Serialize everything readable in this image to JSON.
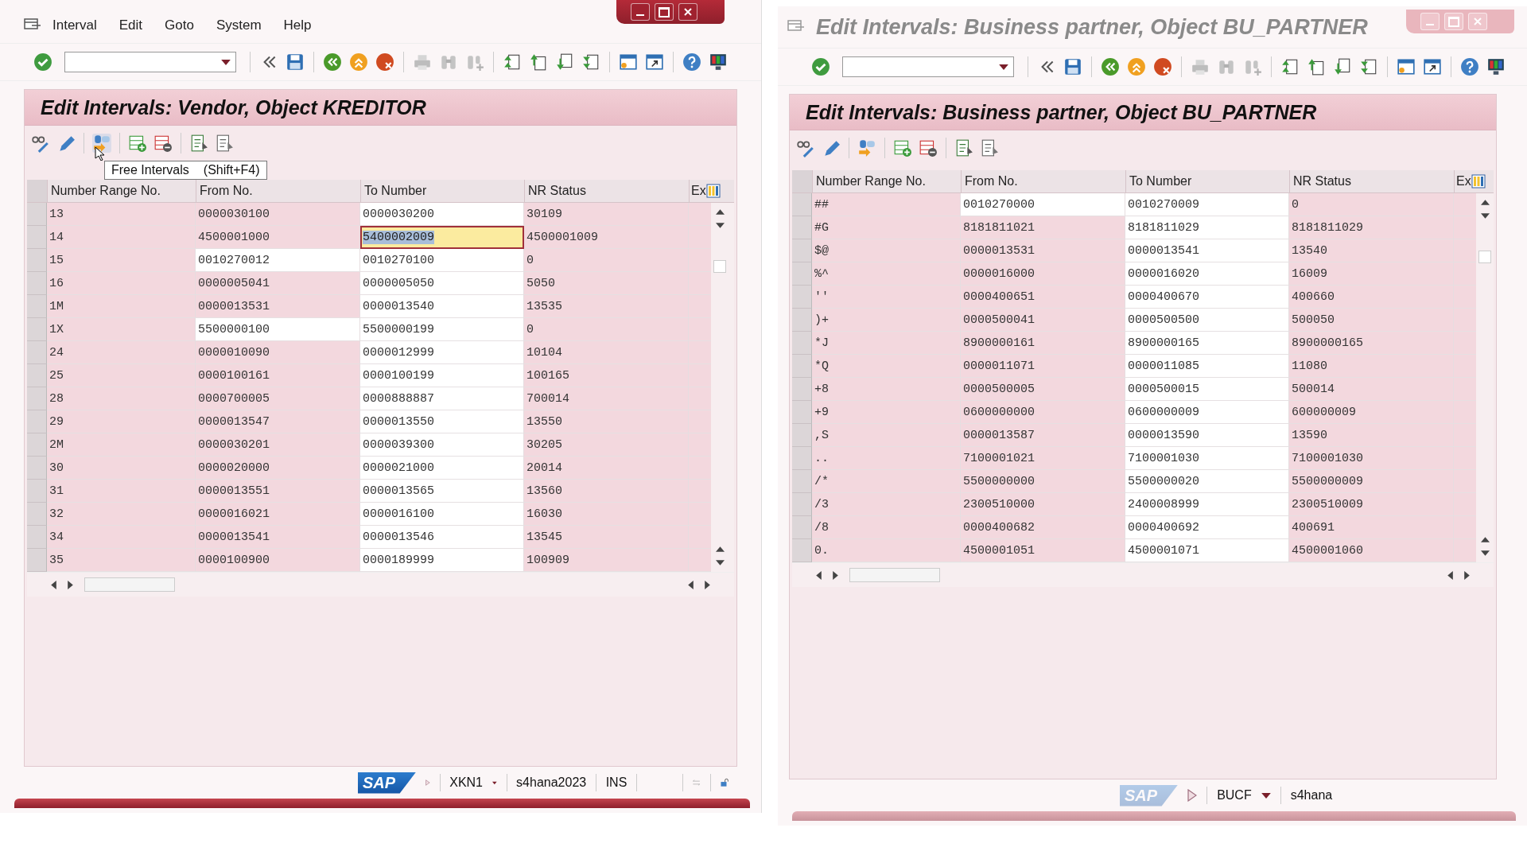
{
  "windows": [
    {
      "active": true,
      "menu": [
        "Interval",
        "Edit",
        "Goto",
        "System",
        "Help"
      ],
      "panel_title": "Edit Intervals: Vendor, Object KREDITOR",
      "tooltip": {
        "label": "Free Intervals",
        "key": "(Shift+F4)"
      },
      "columns": [
        {
          "label": "Number Range No.",
          "editable": false
        },
        {
          "label": "From No.",
          "editable": false
        },
        {
          "label": "To Number",
          "editable": true
        },
        {
          "label": "NR Status",
          "editable": false
        },
        {
          "label": "Ex",
          "editable": false
        }
      ],
      "rows": [
        {
          "range_no": "13",
          "from_no": "0000030100",
          "to_number": "0000030200",
          "nr_status": "30109",
          "from_editable": false,
          "focused": false
        },
        {
          "range_no": "14",
          "from_no": "4500001000",
          "to_number": "5400002009",
          "nr_status": "4500001009",
          "from_editable": false,
          "focused": true
        },
        {
          "range_no": "15",
          "from_no": "0010270012",
          "to_number": "0010270100",
          "nr_status": "0",
          "from_editable": true,
          "focused": false
        },
        {
          "range_no": "16",
          "from_no": "0000005041",
          "to_number": "0000005050",
          "nr_status": "5050",
          "from_editable": false,
          "focused": false
        },
        {
          "range_no": "1M",
          "from_no": "0000013531",
          "to_number": "0000013540",
          "nr_status": "13535",
          "from_editable": false,
          "focused": false
        },
        {
          "range_no": "1X",
          "from_no": "5500000100",
          "to_number": "5500000199",
          "nr_status": "0",
          "from_editable": true,
          "focused": false
        },
        {
          "range_no": "24",
          "from_no": "0000010090",
          "to_number": "0000012999",
          "nr_status": "10104",
          "from_editable": false,
          "focused": false
        },
        {
          "range_no": "25",
          "from_no": "0000100161",
          "to_number": "0000100199",
          "nr_status": "100165",
          "from_editable": false,
          "focused": false
        },
        {
          "range_no": "28",
          "from_no": "0000700005",
          "to_number": "0000888887",
          "nr_status": "700014",
          "from_editable": false,
          "focused": false
        },
        {
          "range_no": "29",
          "from_no": "0000013547",
          "to_number": "0000013550",
          "nr_status": "13550",
          "from_editable": false,
          "focused": false
        },
        {
          "range_no": "2M",
          "from_no": "0000030201",
          "to_number": "0000039300",
          "nr_status": "30205",
          "from_editable": false,
          "focused": false
        },
        {
          "range_no": "30",
          "from_no": "0000020000",
          "to_number": "0000021000",
          "nr_status": "20014",
          "from_editable": false,
          "focused": false
        },
        {
          "range_no": "31",
          "from_no": "0000013551",
          "to_number": "0000013565",
          "nr_status": "13560",
          "from_editable": false,
          "focused": false
        },
        {
          "range_no": "32",
          "from_no": "0000016021",
          "to_number": "0000016100",
          "nr_status": "16030",
          "from_editable": false,
          "focused": false
        },
        {
          "range_no": "34",
          "from_no": "0000013541",
          "to_number": "0000013546",
          "nr_status": "13545",
          "from_editable": false,
          "focused": false
        },
        {
          "range_no": "35",
          "from_no": "0000100900",
          "to_number": "0000189999",
          "nr_status": "100909",
          "from_editable": false,
          "focused": false
        }
      ],
      "status": {
        "logo": "SAP",
        "system": "XKN1",
        "client": "s4hana2023",
        "mode": "INS"
      }
    },
    {
      "active": false,
      "title": "Edit Intervals: Business partner, Object BU_PARTNER",
      "panel_title": "Edit Intervals: Business partner, Object BU_PARTNER",
      "columns": [
        {
          "label": "Number Range No.",
          "editable": false
        },
        {
          "label": "From No.",
          "editable": false
        },
        {
          "label": "To Number",
          "editable": true
        },
        {
          "label": "NR Status",
          "editable": false
        },
        {
          "label": "Ex",
          "editable": false
        }
      ],
      "rows": [
        {
          "range_no": "##",
          "from_no": "0010270000",
          "to_number": "0010270009",
          "nr_status": "0",
          "from_editable": true,
          "focused": false
        },
        {
          "range_no": "#G",
          "from_no": "8181811021",
          "to_number": "8181811029",
          "nr_status": "8181811029",
          "from_editable": false,
          "focused": false
        },
        {
          "range_no": "$@",
          "from_no": "0000013531",
          "to_number": "0000013541",
          "nr_status": "13540",
          "from_editable": false,
          "focused": false
        },
        {
          "range_no": "%^",
          "from_no": "0000016000",
          "to_number": "0000016020",
          "nr_status": "16009",
          "from_editable": false,
          "focused": false
        },
        {
          "range_no": "''",
          "from_no": "0000400651",
          "to_number": "0000400670",
          "nr_status": "400660",
          "from_editable": false,
          "focused": false
        },
        {
          "range_no": ")+",
          "from_no": "0000500041",
          "to_number": "0000500500",
          "nr_status": "500050",
          "from_editable": false,
          "focused": false
        },
        {
          "range_no": "*J",
          "from_no": "8900000161",
          "to_number": "8900000165",
          "nr_status": "8900000165",
          "from_editable": false,
          "focused": false
        },
        {
          "range_no": "*Q",
          "from_no": "0000011071",
          "to_number": "0000011085",
          "nr_status": "11080",
          "from_editable": false,
          "focused": false
        },
        {
          "range_no": "+8",
          "from_no": "0000500005",
          "to_number": "0000500015",
          "nr_status": "500014",
          "from_editable": false,
          "focused": false
        },
        {
          "range_no": "+9",
          "from_no": "0600000000",
          "to_number": "0600000009",
          "nr_status": "600000009",
          "from_editable": false,
          "focused": false
        },
        {
          "range_no": ",S",
          "from_no": "0000013587",
          "to_number": "0000013590",
          "nr_status": "13590",
          "from_editable": false,
          "focused": false
        },
        {
          "range_no": "..",
          "from_no": "7100001021",
          "to_number": "7100001030",
          "nr_status": "7100001030",
          "from_editable": false,
          "focused": false
        },
        {
          "range_no": "/*",
          "from_no": "5500000000",
          "to_number": "5500000020",
          "nr_status": "5500000009",
          "from_editable": false,
          "focused": false
        },
        {
          "range_no": "/3",
          "from_no": "2300510000",
          "to_number": "2400008999",
          "nr_status": "2300510009",
          "from_editable": false,
          "focused": false
        },
        {
          "range_no": "/8",
          "from_no": "0000400682",
          "to_number": "0000400692",
          "nr_status": "400691",
          "from_editable": false,
          "focused": false
        },
        {
          "range_no": "0.",
          "from_no": "4500001051",
          "to_number": "4500001071",
          "nr_status": "4500001060",
          "from_editable": false,
          "focused": false
        }
      ],
      "status": {
        "logo": "SAP",
        "system": "BUCF",
        "client": "s4hana"
      }
    }
  ]
}
